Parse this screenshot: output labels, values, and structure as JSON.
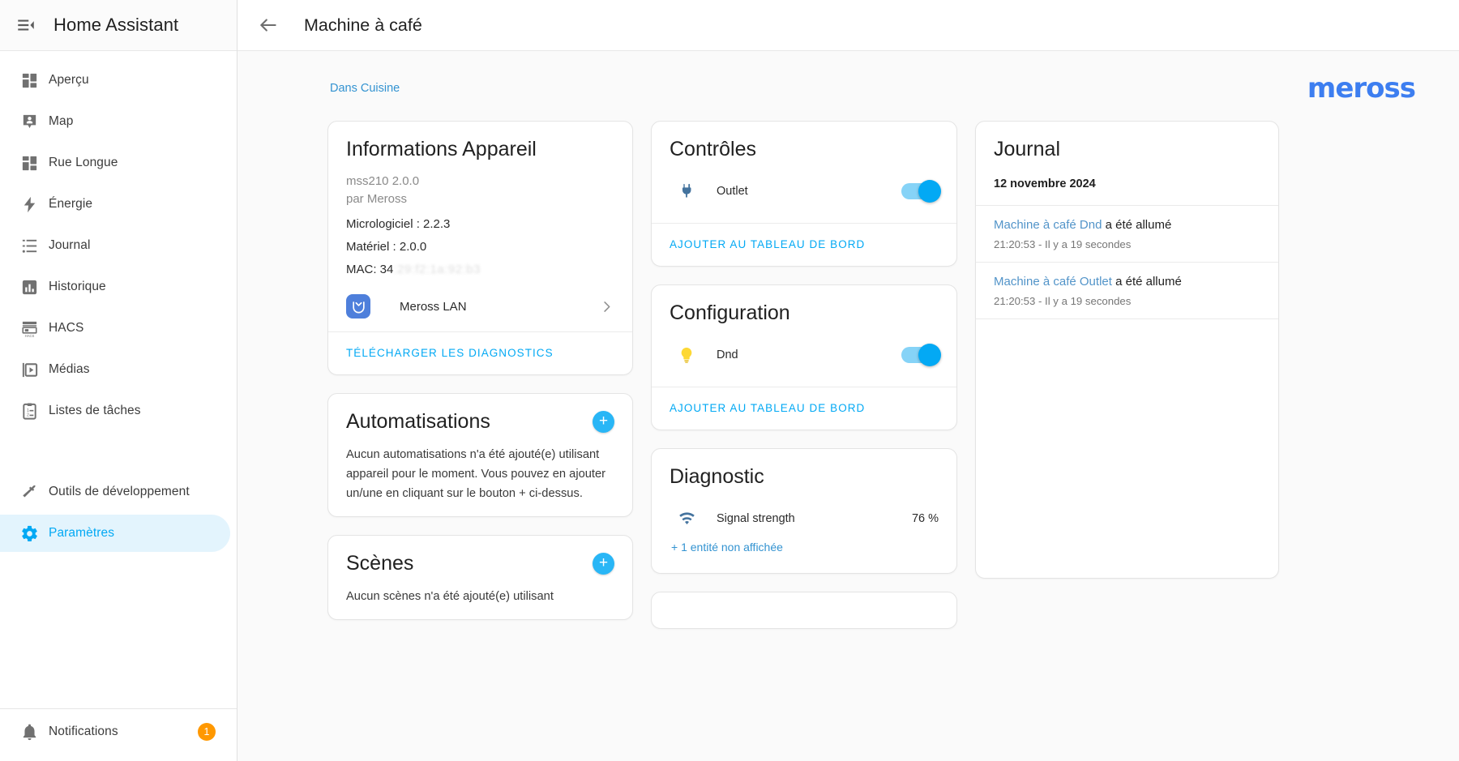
{
  "sidebar": {
    "title": "Home Assistant",
    "menu_icon": "menu-collapse-icon",
    "items": [
      {
        "label": "Aperçu",
        "icon": "dashboard-icon",
        "active": false
      },
      {
        "label": "Map",
        "icon": "map-marker-icon",
        "active": false
      },
      {
        "label": "Rue Longue",
        "icon": "dashboard-icon",
        "active": false
      },
      {
        "label": "Énergie",
        "icon": "lightning-bolt-icon",
        "active": false
      },
      {
        "label": "Journal",
        "icon": "logbook-list-icon",
        "active": false
      },
      {
        "label": "Historique",
        "icon": "chart-bar-icon",
        "active": false
      },
      {
        "label": "HACS",
        "icon": "hacs-store-icon",
        "active": false
      },
      {
        "label": "Médias",
        "icon": "media-play-icon",
        "active": false
      },
      {
        "label": "Listes de tâches",
        "icon": "todo-clipboard-icon",
        "active": false
      }
    ],
    "tools": [
      {
        "label": "Outils de développement",
        "icon": "hammer-wrench-icon",
        "active": false
      },
      {
        "label": "Paramètres",
        "icon": "gear-icon",
        "active": true
      }
    ],
    "notifications": {
      "label": "Notifications",
      "icon": "bell-icon",
      "count": "1"
    }
  },
  "toolbar": {
    "back_icon": "arrow-left-icon",
    "title": "Machine à café"
  },
  "content": {
    "breadcrumb": "Dans Cuisine",
    "brand": "meross"
  },
  "device_info": {
    "title": "Informations Appareil",
    "model": "mss210 2.0.0",
    "manufacturer": "par Meross",
    "firmware": "Micrologiciel : 2.2.3",
    "hardware": "Matériel : 2.0.0",
    "mac_label": "MAC: 34",
    "mac_redacted": ":29:f2:1a:92:b3",
    "integration": {
      "name": "Meross LAN",
      "icon": "meross-integration-icon",
      "chevron": "chevron-right-icon"
    },
    "action": "TÉLÉCHARGER LES DIAGNOSTICS"
  },
  "automations": {
    "title": "Automatisations",
    "add_icon": "plus-circle-icon",
    "empty_text": "Aucun automatisations n'a été ajouté(e) utilisant appareil pour le moment. Vous pouvez en ajouter un/une en cliquant sur le bouton + ci-dessus."
  },
  "scenes": {
    "title": "Scènes",
    "add_icon": "plus-circle-icon",
    "empty_text": "Aucun scènes n'a été ajouté(e) utilisant"
  },
  "controls": {
    "title": "Contrôles",
    "entities": [
      {
        "name": "Outlet",
        "icon": "power-plug-icon",
        "state": "on"
      }
    ],
    "action": "AJOUTER AU TABLEAU DE BORD"
  },
  "configuration": {
    "title": "Configuration",
    "entities": [
      {
        "name": "Dnd",
        "icon": "lightbulb-icon",
        "state": "on"
      }
    ],
    "action": "AJOUTER AU TABLEAU DE BORD"
  },
  "diagnostic": {
    "title": "Diagnostic",
    "entities": [
      {
        "name": "Signal strength",
        "icon": "wifi-icon",
        "value": "76 %"
      }
    ],
    "hidden_link": "+ 1 entité non affichée"
  },
  "logbook": {
    "title": "Journal",
    "date": "12 novembre 2024",
    "entries": [
      {
        "entity": "Machine à café Dnd",
        "text": " a été allumé",
        "time": "21:20:53 - Il y a 19 secondes"
      },
      {
        "entity": "Machine à café Outlet",
        "text": " a été allumé",
        "time": "21:20:53 - Il y a 19 secondes"
      }
    ]
  },
  "colors": {
    "accent": "#03a9f4",
    "link": "#3393d1",
    "brand": "#3d7ef0",
    "badge": "#ff9800",
    "active_bg": "#e3f4fd"
  }
}
